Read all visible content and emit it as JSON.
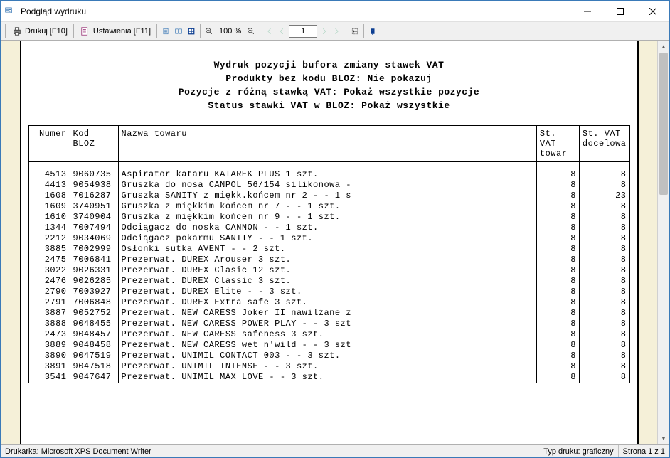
{
  "window": {
    "title": "Podgląd wydruku"
  },
  "toolbar": {
    "print": "Drukuj [F10]",
    "settings": "Ustawienia [F11]",
    "zoom": "100 %",
    "page": "1"
  },
  "report": {
    "header_lines": [
      "Wydruk pozycji bufora zmiany stawek VAT",
      "Produkty bez kodu BLOZ: Nie pokazuj",
      "Pozycje z różną stawką VAT: Pokaż wszystkie pozycje",
      "Status stawki VAT w BLOZ: Pokaż wszystkie"
    ],
    "columns": {
      "num": "Numer",
      "bloz": "Kod BLOZ",
      "name": "Nazwa towaru",
      "vat_item": "St. VAT towar",
      "vat_target": "St. VAT docelowa"
    },
    "rows": [
      {
        "num": "4513",
        "bloz": "9060735",
        "name": "Aspirator kataru KATAREK PLUS 1 szt.",
        "v1": "8",
        "v2": "8"
      },
      {
        "num": "4413",
        "bloz": "9054938",
        "name": "Gruszka do nosa CANPOL 56/154 silikonowa -",
        "v1": "8",
        "v2": "8"
      },
      {
        "num": "1608",
        "bloz": "7016287",
        "name": "Gruszka SANITY z miękk.końcem nr 2 - - 1 s",
        "v1": "8",
        "v2": "23"
      },
      {
        "num": "1609",
        "bloz": "3740951",
        "name": "Gruszka z miękkim końcem nr  7 - - 1 szt.",
        "v1": "8",
        "v2": "8"
      },
      {
        "num": "1610",
        "bloz": "3740904",
        "name": "Gruszka z miękkim końcem nr  9 - - 1 szt.",
        "v1": "8",
        "v2": "8"
      },
      {
        "num": "1344",
        "bloz": "7007494",
        "name": "Odciągacz do noska CANNON - - 1 szt.",
        "v1": "8",
        "v2": "8"
      },
      {
        "num": "2212",
        "bloz": "9034069",
        "name": "Odciągacz pokarmu SANITY - - 1 szt.",
        "v1": "8",
        "v2": "8"
      },
      {
        "num": "3885",
        "bloz": "7002999",
        "name": "Osłonki sutka AVENT - -  2 szt.",
        "v1": "8",
        "v2": "8"
      },
      {
        "num": "2475",
        "bloz": "7006841",
        "name": "Prezerwat. DUREX Arouser 3 szt.",
        "v1": "8",
        "v2": "8"
      },
      {
        "num": "3022",
        "bloz": "9026331",
        "name": "Prezerwat. DUREX Clasic 12 szt.",
        "v1": "8",
        "v2": "8"
      },
      {
        "num": "2476",
        "bloz": "9026285",
        "name": "Prezerwat. DUREX Classic 3 szt.",
        "v1": "8",
        "v2": "8"
      },
      {
        "num": "2790",
        "bloz": "7003927",
        "name": "Prezerwat. DUREX Elite - - 3 szt.",
        "v1": "8",
        "v2": "8"
      },
      {
        "num": "2791",
        "bloz": "7006848",
        "name": "Prezerwat. DUREX Extra safe 3 szt.",
        "v1": "8",
        "v2": "8"
      },
      {
        "num": "3887",
        "bloz": "9052752",
        "name": "Prezerwat. NEW CARESS Joker II nawilżane z",
        "v1": "8",
        "v2": "8"
      },
      {
        "num": "3888",
        "bloz": "9048455",
        "name": "Prezerwat. NEW CARESS POWER PLAY - - 3 szt",
        "v1": "8",
        "v2": "8"
      },
      {
        "num": "2473",
        "bloz": "9048457",
        "name": "Prezerwat. NEW CARESS safeness 3 szt.",
        "v1": "8",
        "v2": "8"
      },
      {
        "num": "3889",
        "bloz": "9048458",
        "name": "Prezerwat. NEW CARESS wet n'wild - - 3 szt",
        "v1": "8",
        "v2": "8"
      },
      {
        "num": "3890",
        "bloz": "9047519",
        "name": "Prezerwat. UNIMIL CONTACT 003 - - 3 szt.",
        "v1": "8",
        "v2": "8"
      },
      {
        "num": "3891",
        "bloz": "9047518",
        "name": "Prezerwat. UNIMIL INTENSE - - 3 szt.",
        "v1": "8",
        "v2": "8"
      },
      {
        "num": "3541",
        "bloz": "9047647",
        "name": "Prezerwat. UNIMIL MAX LOVE - - 3 szt.",
        "v1": "8",
        "v2": "8"
      }
    ]
  },
  "status": {
    "printer": "Drukarka: Microsoft XPS Document Writer",
    "type": "Typ druku: graficzny",
    "page": "Strona 1 z 1"
  }
}
